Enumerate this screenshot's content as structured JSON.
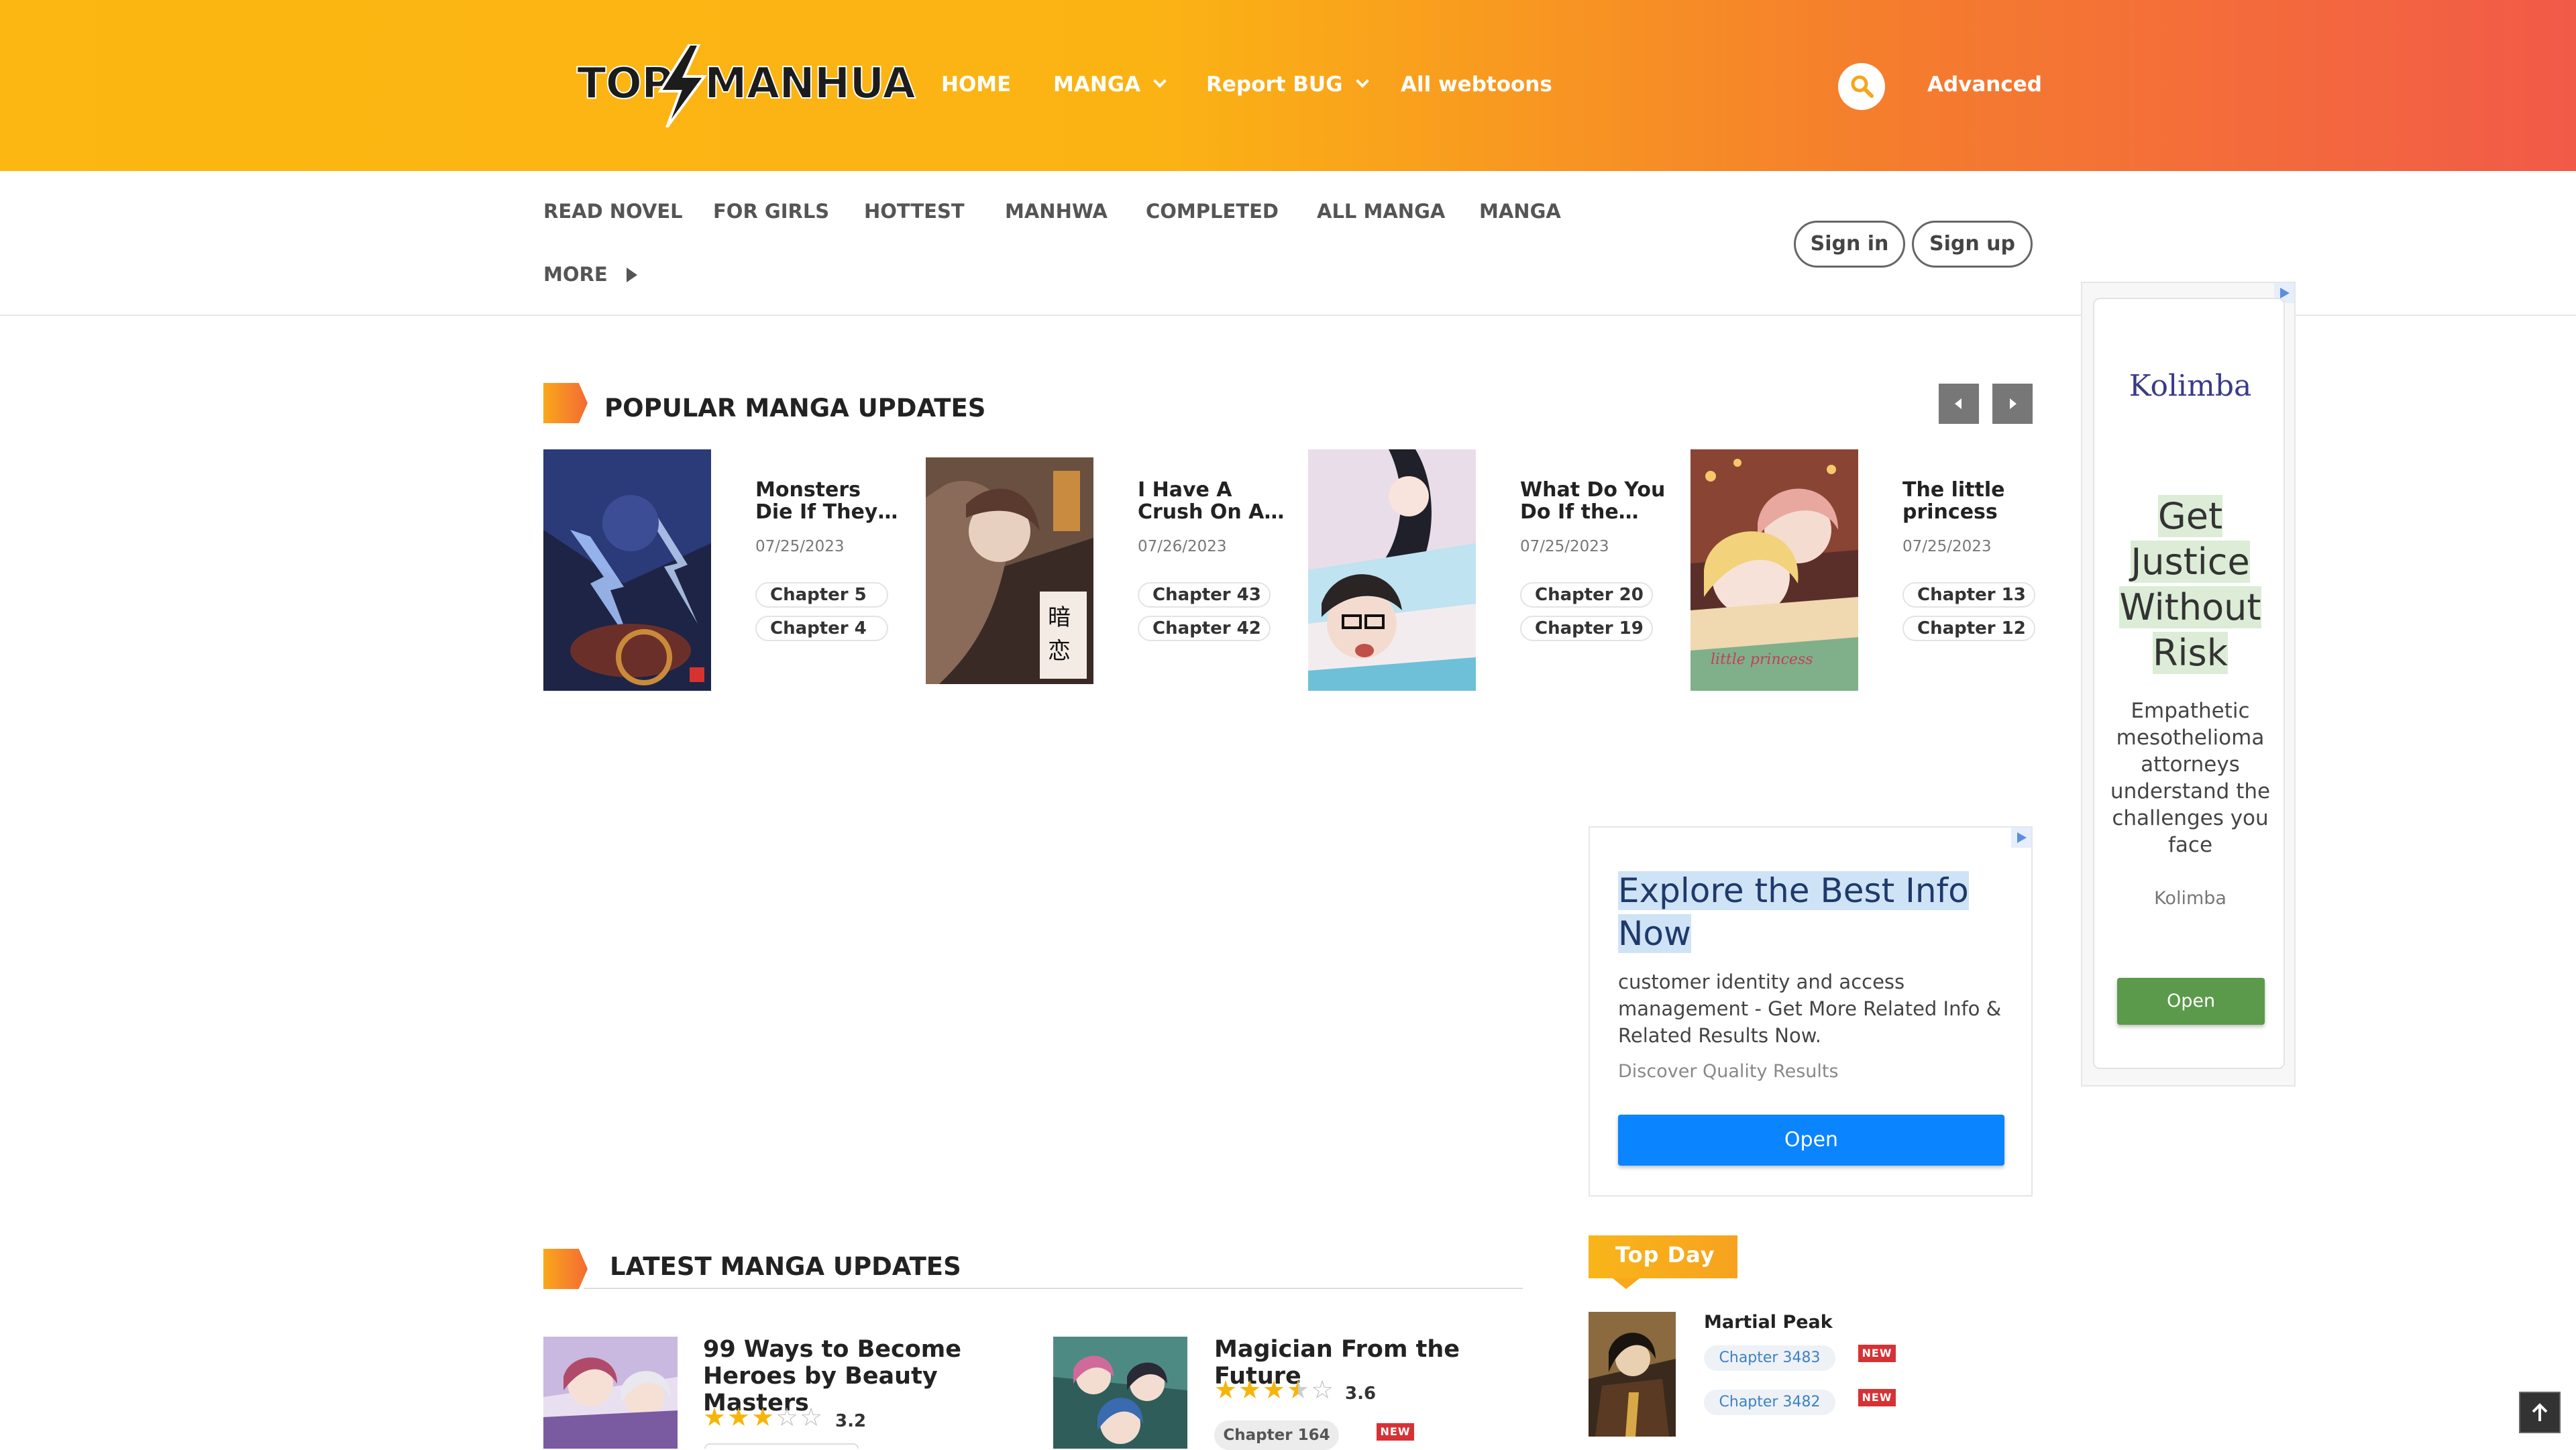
{
  "header": {
    "logo_left": "TOP",
    "logo_right": "MANHUA",
    "nav": [
      {
        "label": "HOME"
      },
      {
        "label": "MANGA"
      },
      {
        "label": "Report BUG"
      },
      {
        "label": "All webtoons"
      }
    ],
    "advanced_label": "Advanced"
  },
  "subnav": {
    "items": [
      "READ NOVEL",
      "FOR GIRLS",
      "HOTTEST",
      "MANHWA",
      "COMPLETED",
      "ALL MANGA",
      "MANGA"
    ],
    "more_label": "MORE",
    "signin_label": "Sign in",
    "signup_label": "Sign up"
  },
  "popular": {
    "title": "POPULAR MANGA UPDATES",
    "cards": [
      {
        "title": "Monsters Die If They…",
        "date": "07/25/2023",
        "chapters": [
          "Chapter 5",
          "Chapter 4"
        ]
      },
      {
        "title": "I Have A Crush On A…",
        "date": "07/26/2023",
        "chapters": [
          "Chapter 43",
          "Chapter 42"
        ]
      },
      {
        "title": "What Do You Do If the…",
        "date": "07/25/2023",
        "chapters": [
          "Chapter 20",
          "Chapter 19"
        ]
      },
      {
        "title": "The little princess",
        "date": "07/25/2023",
        "chapters": [
          "Chapter 13",
          "Chapter 12"
        ]
      }
    ]
  },
  "ad_mid": {
    "headline": "Explore the Best Info Now",
    "body": "customer identity and access management - Get More Related Info & Related Results Now.",
    "source": "Discover Quality Results",
    "button": "Open"
  },
  "ad_right": {
    "brand": "Kolimba",
    "headline": "Get Justice Without Risk",
    "body": "Empathetic mesothelioma attorneys understand the challenges you face",
    "source": "Kolimba",
    "button": "Open"
  },
  "latest": {
    "title": "LATEST MANGA UPDATES",
    "items": [
      {
        "title": "99 Ways to Become Heroes by Beauty Masters",
        "rating": "3.2",
        "rating_value": 3.2
      },
      {
        "title": "Magician From the Future",
        "rating": "3.6",
        "rating_value": 3.6,
        "chapter": "Chapter 164",
        "badge": "NEW"
      }
    ]
  },
  "top_day": {
    "tab_label": "Top Day",
    "item": {
      "title": "Martial Peak",
      "chapters": [
        {
          "label": "Chapter 3483",
          "badge": "NEW"
        },
        {
          "label": "Chapter 3482",
          "badge": "NEW"
        }
      ]
    }
  },
  "colors": {
    "header_start": "#fcb712",
    "header_end": "#f25a48",
    "ad_button_blue": "#0a84ff",
    "ad_button_green": "#5a9a4a",
    "star": "#f5b50a"
  }
}
